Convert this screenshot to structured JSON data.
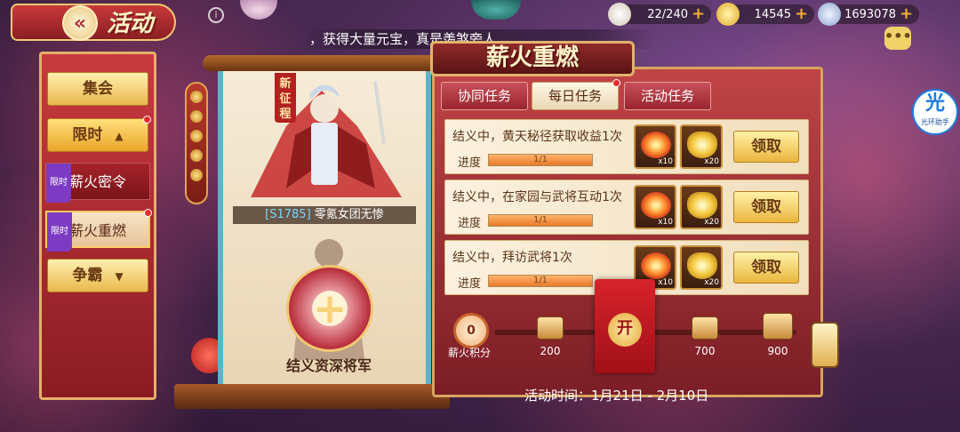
{
  "header": {
    "title": "活动",
    "back_icon": "«",
    "info_icon": "i",
    "marquee": "，获得大量元宝，真是羡煞旁人"
  },
  "resources": [
    {
      "name": "food",
      "value": "22/240",
      "color": "#e8e0d0"
    },
    {
      "name": "gold-ingot",
      "value": "14545",
      "color": "#f2c034"
    },
    {
      "name": "silver-coin",
      "value": "1693078",
      "color": "#b9c7e8"
    }
  ],
  "helper_badge": {
    "glyph": "光",
    "label": "光环助手"
  },
  "sidebar": {
    "items": [
      {
        "label": "集会",
        "type": "main"
      },
      {
        "label": "限时",
        "type": "main",
        "arrow": "▲"
      },
      {
        "label": "薪火密令",
        "type": "sub",
        "tag": "限时"
      },
      {
        "label": "薪火重燃",
        "type": "sub",
        "tag": "限时"
      },
      {
        "label": "争霸",
        "type": "main",
        "arrow": "▼"
      }
    ]
  },
  "character": {
    "new_tag": "新征程",
    "server_id": "[S1785]",
    "player_name": "零氪女团无惨",
    "recruit_label": "结义资深将军",
    "add_glyph": "+"
  },
  "panel": {
    "title": "薪火重燃",
    "tabs": [
      {
        "label": "协同任务",
        "active": false
      },
      {
        "label": "每日任务",
        "active": true
      },
      {
        "label": "活动任务",
        "active": false
      }
    ],
    "progress_label": "进度",
    "claim_label": "领取",
    "tasks": [
      {
        "text": "结义中，黄天秘径获取收益1次",
        "progress_text": "1/1",
        "progress": 1.0,
        "rewards": [
          {
            "icon": "fire",
            "qty": "x10"
          },
          {
            "icon": "ingot",
            "qty": "x20"
          }
        ]
      },
      {
        "text": "结义中，在家园与武将互动1次",
        "progress_text": "1/1",
        "progress": 1.0,
        "rewards": [
          {
            "icon": "fire",
            "qty": "x10"
          },
          {
            "icon": "ingot",
            "qty": "x20"
          }
        ]
      },
      {
        "text": "结义中，拜访武将1次",
        "progress_text": "1/1",
        "progress": 1.0,
        "rewards": [
          {
            "icon": "fire",
            "qty": "x10"
          },
          {
            "icon": "ingot",
            "qty": "x20"
          }
        ]
      }
    ]
  },
  "points": {
    "value": "0",
    "label": "薪火积分",
    "milestones": [
      "200",
      "700",
      "900"
    ],
    "packet_glyph": "开"
  },
  "event_time": "活动时间：1月21日 - 2月10日"
}
